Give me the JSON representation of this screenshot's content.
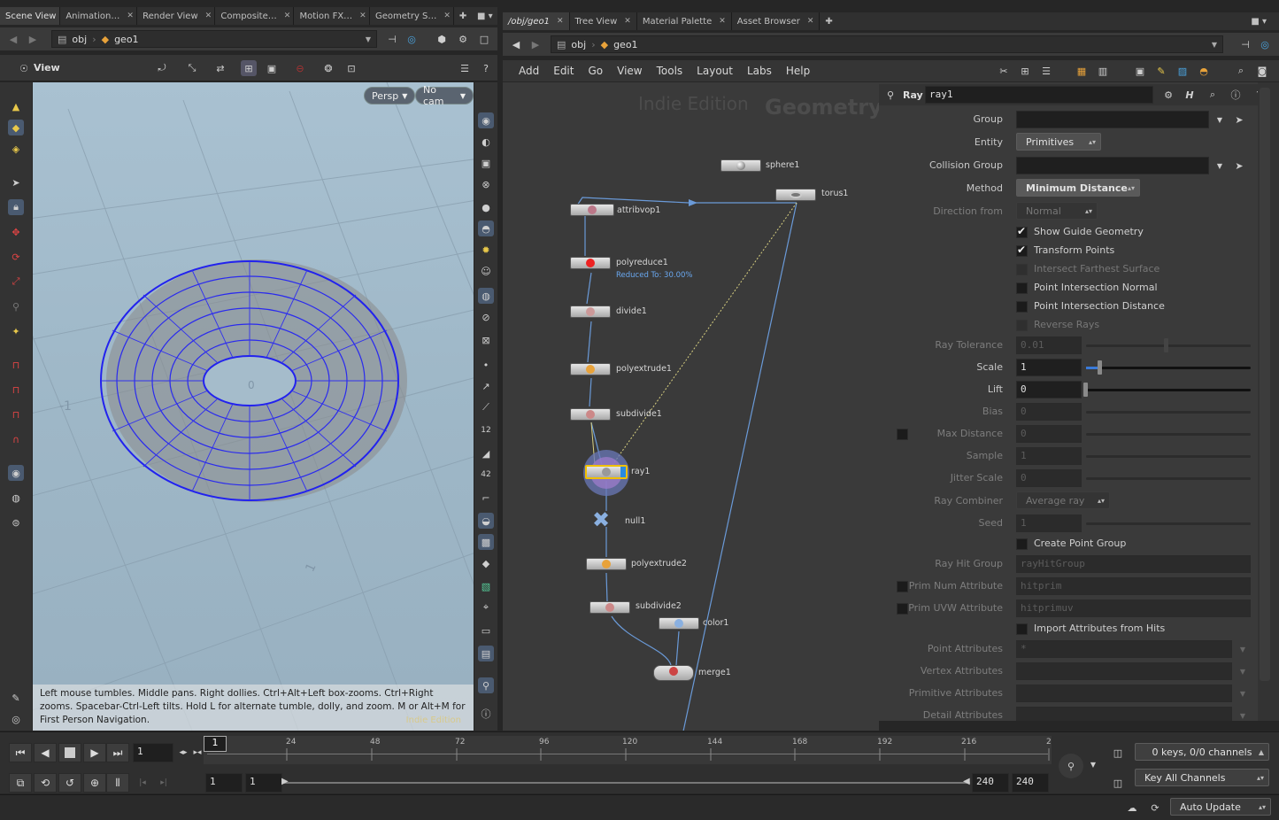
{
  "top_left_tabs": [
    "Scene View",
    "Animation…",
    "Render View",
    "Composite…",
    "Motion FX…",
    "Geometry S…"
  ],
  "top_right_tabs": [
    "/obj/geo1",
    "Tree View",
    "Material Palette",
    "Asset Browser"
  ],
  "left_path": {
    "root": "obj",
    "node": "geo1"
  },
  "right_path": {
    "root": "obj",
    "node": "geo1"
  },
  "viewport": {
    "toolbar_label": "View",
    "persp_label": "Persp",
    "cam_label": "No cam",
    "axis_labels": [
      "-1",
      "0",
      "1"
    ],
    "help_text": "Left mouse tumbles. Middle pans. Right dollies. Ctrl+Alt+Left box-zooms. Ctrl+Right zooms. Spacebar-Ctrl-Left tilts. Hold L for alternate tumble, dolly, and zoom.    M or Alt+M for First Person Navigation.",
    "watermark": "Indie Edition"
  },
  "network": {
    "menu": [
      "Add",
      "Edit",
      "Go",
      "View",
      "Tools",
      "Layout",
      "Labs",
      "Help"
    ],
    "watermark_left": "Indie Edition",
    "watermark_right": "Geometry",
    "nodes": [
      {
        "name": "sphere1"
      },
      {
        "name": "torus1"
      },
      {
        "name": "attribvop1"
      },
      {
        "name": "polyreduce1",
        "sub": "Reduced To: 30.00%"
      },
      {
        "name": "divide1"
      },
      {
        "name": "polyextrude1"
      },
      {
        "name": "subdivide1"
      },
      {
        "name": "ray1"
      },
      {
        "name": "null1"
      },
      {
        "name": "polyextrude2"
      },
      {
        "name": "subdivide2"
      },
      {
        "name": "color1"
      },
      {
        "name": "merge1"
      }
    ]
  },
  "params": {
    "node_type": "Ray",
    "node_name": "ray1",
    "group_label": "Group",
    "entity_label": "Entity",
    "entity_value": "Primitives",
    "collision_group_label": "Collision Group",
    "method_label": "Method",
    "method_value": "Minimum Distance",
    "direction_label": "Direction from",
    "direction_value": "Normal",
    "show_guide": "Show Guide Geometry",
    "transform_points": "Transform Points",
    "intersect_farthest": "Intersect Farthest Surface",
    "point_normal": "Point Intersection Normal",
    "point_distance": "Point Intersection Distance",
    "reverse_rays": "Reverse Rays",
    "ray_tolerance_label": "Ray Tolerance",
    "ray_tolerance_value": "0.01",
    "scale_label": "Scale",
    "scale_value": "1",
    "lift_label": "Lift",
    "lift_value": "0",
    "bias_label": "Bias",
    "bias_value": "0",
    "max_distance_label": "Max Distance",
    "max_distance_value": "0",
    "sample_label": "Sample",
    "sample_value": "1",
    "jitter_label": "Jitter Scale",
    "jitter_value": "0",
    "combiner_label": "Ray Combiner",
    "combiner_value": "Average ray",
    "seed_label": "Seed",
    "seed_value": "1",
    "create_point_group": "Create Point Group",
    "ray_hit_group_label": "Ray Hit Group",
    "ray_hit_group_value": "rayHitGroup",
    "prim_num_label": "Prim Num Attribute",
    "prim_num_value": "hitprim",
    "prim_uvw_label": "Prim UVW Attribute",
    "prim_uvw_value": "hitprimuv",
    "import_attrs": "Import Attributes from Hits",
    "point_attrs_label": "Point Attributes",
    "point_attrs_value": "*",
    "vertex_attrs_label": "Vertex Attributes",
    "primitive_attrs_label": "Primitive Attributes",
    "detail_attrs_label": "Detail Attributes"
  },
  "timeline": {
    "current_frame": "1",
    "frame_marker": "1",
    "ticks": [
      "24",
      "48",
      "72",
      "96",
      "120",
      "144",
      "168",
      "192",
      "216",
      "2"
    ],
    "start1": "1",
    "start2": "1",
    "end1": "240",
    "end2": "240",
    "keys_label": "0 keys, 0/0 channels",
    "key_all_label": "Key All Channels",
    "auto_update_label": "Auto Update"
  }
}
